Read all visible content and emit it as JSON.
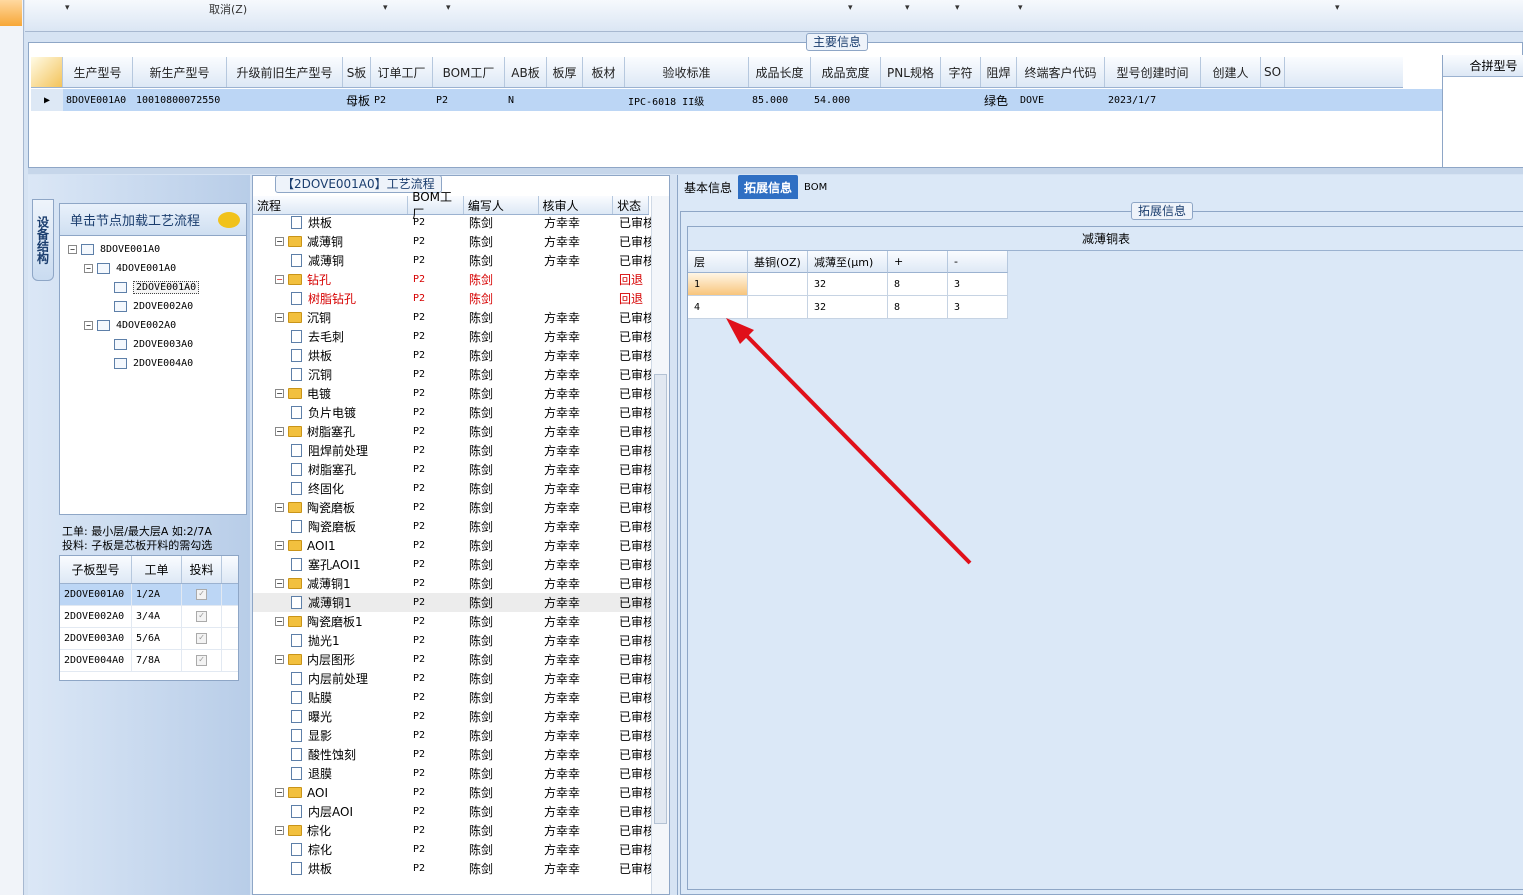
{
  "toolbar": {
    "cancel_label": "取消(Z)"
  },
  "main_info": {
    "title": "主要信息",
    "columns": [
      "生产型号",
      "新生产型号",
      "升级前旧生产型号",
      "S板",
      "订单工厂",
      "BOM工厂",
      "AB板",
      "板厚",
      "板材",
      "验收标准",
      "成品长度",
      "成品宽度",
      "PNL规格",
      "字符",
      "阻焊",
      "终端客户代码",
      "型号创建时间",
      "创建人",
      "SO"
    ],
    "row": {
      "model": "8DOVE001A0",
      "new_model": "10010800072550",
      "board": "母板",
      "order_factory": "P2",
      "bom_factory": "P2",
      "ab": "N",
      "standard": "IPC-6018 II级",
      "length": "85.000",
      "width": "54.000",
      "mask": "绿色",
      "customer": "DOVE",
      "created": "2023/1/7"
    },
    "merge_title": "合拼型号"
  },
  "left": {
    "side_tab": "设备结构",
    "tree_header": "单击节点加载工艺流程",
    "tree": [
      "8DOVE001A0",
      "4DOVE001A0",
      "2DOVE001A0",
      "2DOVE002A0",
      "4DOVE002A0",
      "2DOVE003A0",
      "2DOVE004A0"
    ],
    "hint1": "工单: 最小层/最大层A 如:2/7A",
    "hint2": "投料: 子板是芯板开料的需勾选",
    "sub_cols": [
      "子板型号",
      "工单",
      "投料"
    ],
    "sub_rows": [
      {
        "model": "2DOVE001A0",
        "order": "1/2A"
      },
      {
        "model": "2DOVE002A0",
        "order": "3/4A"
      },
      {
        "model": "2DOVE003A0",
        "order": "5/6A"
      },
      {
        "model": "2DOVE004A0",
        "order": "7/8A"
      }
    ]
  },
  "process": {
    "title": "【2DOVE001A0】工艺流程",
    "cols": [
      "流程",
      "BOM工厂",
      "编写人",
      "核审人",
      "状态"
    ],
    "rows": [
      {
        "name": "烘板",
        "lvl": 2,
        "f": "P2",
        "w": "陈剑",
        "r": "方幸幸",
        "s": "已审核"
      },
      {
        "name": "减薄铜",
        "lvl": 1,
        "f": "P2",
        "w": "陈剑",
        "r": "方幸幸",
        "s": "已审核"
      },
      {
        "name": "减薄铜",
        "lvl": 2,
        "f": "P2",
        "w": "陈剑",
        "r": "方幸幸",
        "s": "已审核"
      },
      {
        "name": "钻孔",
        "lvl": 1,
        "f": "P2",
        "w": "陈剑",
        "r": "",
        "s": "回退",
        "red": true
      },
      {
        "name": "树脂钻孔",
        "lvl": 2,
        "f": "P2",
        "w": "陈剑",
        "r": "",
        "s": "回退",
        "red": true
      },
      {
        "name": "沉铜",
        "lvl": 1,
        "f": "P2",
        "w": "陈剑",
        "r": "方幸幸",
        "s": "已审核"
      },
      {
        "name": "去毛刺",
        "lvl": 2,
        "f": "P2",
        "w": "陈剑",
        "r": "方幸幸",
        "s": "已审核"
      },
      {
        "name": "烘板",
        "lvl": 2,
        "f": "P2",
        "w": "陈剑",
        "r": "方幸幸",
        "s": "已审核"
      },
      {
        "name": "沉铜",
        "lvl": 2,
        "f": "P2",
        "w": "陈剑",
        "r": "方幸幸",
        "s": "已审核"
      },
      {
        "name": "电镀",
        "lvl": 1,
        "f": "P2",
        "w": "陈剑",
        "r": "方幸幸",
        "s": "已审核"
      },
      {
        "name": "负片电镀",
        "lvl": 2,
        "f": "P2",
        "w": "陈剑",
        "r": "方幸幸",
        "s": "已审核"
      },
      {
        "name": "树脂塞孔",
        "lvl": 1,
        "f": "P2",
        "w": "陈剑",
        "r": "方幸幸",
        "s": "已审核"
      },
      {
        "name": "阻焊前处理",
        "lvl": 2,
        "f": "P2",
        "w": "陈剑",
        "r": "方幸幸",
        "s": "已审核"
      },
      {
        "name": "树脂塞孔",
        "lvl": 2,
        "f": "P2",
        "w": "陈剑",
        "r": "方幸幸",
        "s": "已审核"
      },
      {
        "name": "终固化",
        "lvl": 2,
        "f": "P2",
        "w": "陈剑",
        "r": "方幸幸",
        "s": "已审核"
      },
      {
        "name": "陶瓷磨板",
        "lvl": 1,
        "f": "P2",
        "w": "陈剑",
        "r": "方幸幸",
        "s": "已审核"
      },
      {
        "name": "陶瓷磨板",
        "lvl": 2,
        "f": "P2",
        "w": "陈剑",
        "r": "方幸幸",
        "s": "已审核"
      },
      {
        "name": "AOI1",
        "lvl": 1,
        "f": "P2",
        "w": "陈剑",
        "r": "方幸幸",
        "s": "已审核"
      },
      {
        "name": "塞孔AOI1",
        "lvl": 2,
        "f": "P2",
        "w": "陈剑",
        "r": "方幸幸",
        "s": "已审核"
      },
      {
        "name": "减薄铜1",
        "lvl": 1,
        "f": "P2",
        "w": "陈剑",
        "r": "方幸幸",
        "s": "已审核"
      },
      {
        "name": "减薄铜1",
        "lvl": 2,
        "f": "P2",
        "w": "陈剑",
        "r": "方幸幸",
        "s": "已审核",
        "hl": true
      },
      {
        "name": "陶瓷磨板1",
        "lvl": 1,
        "f": "P2",
        "w": "陈剑",
        "r": "方幸幸",
        "s": "已审核"
      },
      {
        "name": "抛光1",
        "lvl": 2,
        "f": "P2",
        "w": "陈剑",
        "r": "方幸幸",
        "s": "已审核"
      },
      {
        "name": "内层图形",
        "lvl": 1,
        "f": "P2",
        "w": "陈剑",
        "r": "方幸幸",
        "s": "已审核"
      },
      {
        "name": "内层前处理",
        "lvl": 2,
        "f": "P2",
        "w": "陈剑",
        "r": "方幸幸",
        "s": "已审核"
      },
      {
        "name": "贴膜",
        "lvl": 2,
        "f": "P2",
        "w": "陈剑",
        "r": "方幸幸",
        "s": "已审核"
      },
      {
        "name": "曝光",
        "lvl": 2,
        "f": "P2",
        "w": "陈剑",
        "r": "方幸幸",
        "s": "已审核"
      },
      {
        "name": "显影",
        "lvl": 2,
        "f": "P2",
        "w": "陈剑",
        "r": "方幸幸",
        "s": "已审核"
      },
      {
        "name": "酸性蚀刻",
        "lvl": 2,
        "f": "P2",
        "w": "陈剑",
        "r": "方幸幸",
        "s": "已审核"
      },
      {
        "name": "退膜",
        "lvl": 2,
        "f": "P2",
        "w": "陈剑",
        "r": "方幸幸",
        "s": "已审核"
      },
      {
        "name": "AOI",
        "lvl": 1,
        "f": "P2",
        "w": "陈剑",
        "r": "方幸幸",
        "s": "已审核"
      },
      {
        "name": "内层AOI",
        "lvl": 2,
        "f": "P2",
        "w": "陈剑",
        "r": "方幸幸",
        "s": "已审核"
      },
      {
        "name": "棕化",
        "lvl": 1,
        "f": "P2",
        "w": "陈剑",
        "r": "方幸幸",
        "s": "已审核"
      },
      {
        "name": "棕化",
        "lvl": 2,
        "f": "P2",
        "w": "陈剑",
        "r": "方幸幸",
        "s": "已审核"
      },
      {
        "name": "烘板",
        "lvl": 2,
        "f": "P2",
        "w": "陈剑",
        "r": "方幸幸",
        "s": "已审核"
      }
    ]
  },
  "right": {
    "tabs": [
      "基本信息",
      "拓展信息",
      "BOM"
    ],
    "group_title": "拓展信息",
    "table_title": "减薄铜表",
    "cols": [
      "层",
      "基铜(OZ)",
      "减薄至(μm)",
      "+",
      "-"
    ],
    "rows": [
      {
        "layer": "1",
        "base": "",
        "thin": "32",
        "plus": "8",
        "minus": "3"
      },
      {
        "layer": "4",
        "base": "",
        "thin": "32",
        "plus": "8",
        "minus": "3"
      }
    ]
  },
  "colors": {
    "arrow": "#e0101a",
    "selected_row": "#bcd6f5",
    "tab_active": "#2f6fc3"
  }
}
